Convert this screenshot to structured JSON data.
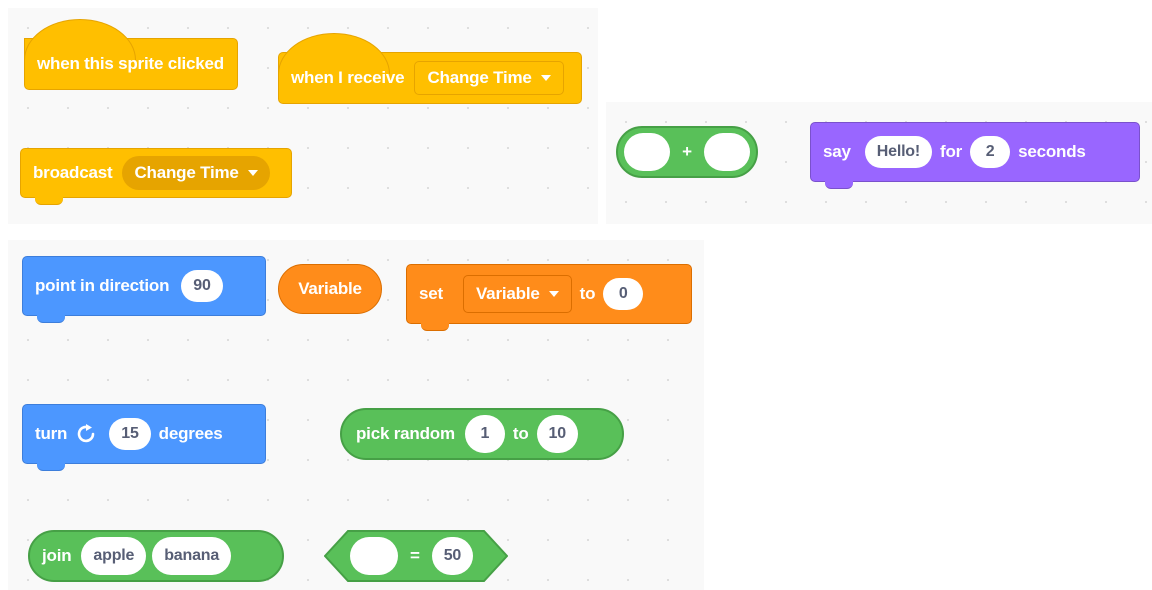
{
  "colors": {
    "events": "#ffbf00",
    "motion": "#4c97ff",
    "looks": "#9966ff",
    "operators": "#59c059",
    "variables": "#ff8c1a"
  },
  "events": {
    "when_clicked": "when this sprite clicked",
    "when_receive": "when I receive",
    "when_receive_message": "Change Time",
    "broadcast": "broadcast",
    "broadcast_message": "Change Time"
  },
  "operators_add": {
    "symbol": "+"
  },
  "looks": {
    "say": "say",
    "message": "Hello!",
    "for": "for",
    "secs": "2",
    "seconds": "seconds"
  },
  "motion": {
    "point": "point in direction",
    "point_value": "90",
    "turn": "turn",
    "turn_icon": "rotate-clockwise-icon",
    "turn_value": "15",
    "degrees": "degrees"
  },
  "variables": {
    "reporter": "Variable",
    "set": "set",
    "set_var": "Variable",
    "to": "to",
    "set_value": "0"
  },
  "operators": {
    "pick_random": "pick random",
    "from": "1",
    "to": "to",
    "to_value": "10",
    "join": "join",
    "join_a": "apple",
    "join_b": "banana",
    "equals_symbol": "=",
    "equals_value": "50"
  }
}
